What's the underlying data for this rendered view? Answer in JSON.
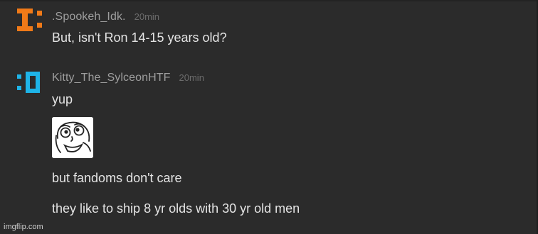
{
  "messages": [
    {
      "username": ".Spookeh_Idk.",
      "timestamp": "20min",
      "avatar_icon": "orange-pixel-avatar-icon",
      "avatar_color": "#f07a18",
      "lines": [
        "But, isn't Ron 14-15 years old?"
      ]
    },
    {
      "username": "Kitty_The_SylceonHTF",
      "timestamp": "20min",
      "avatar_icon": "cyan-pixel-avatar-icon",
      "avatar_color": "#1eb4e8",
      "lines": [
        "yup",
        "but fandoms don't care",
        "they like to ship 8 yr olds with 30 yr old men"
      ],
      "image_icon": "derp-face-meme-icon"
    }
  ],
  "watermark": "imgflip.com",
  "colors": {
    "background": "#2b2b2b",
    "username": "#9e9e9e",
    "timestamp": "#6c6c6c",
    "text": "#e4e4e4"
  }
}
